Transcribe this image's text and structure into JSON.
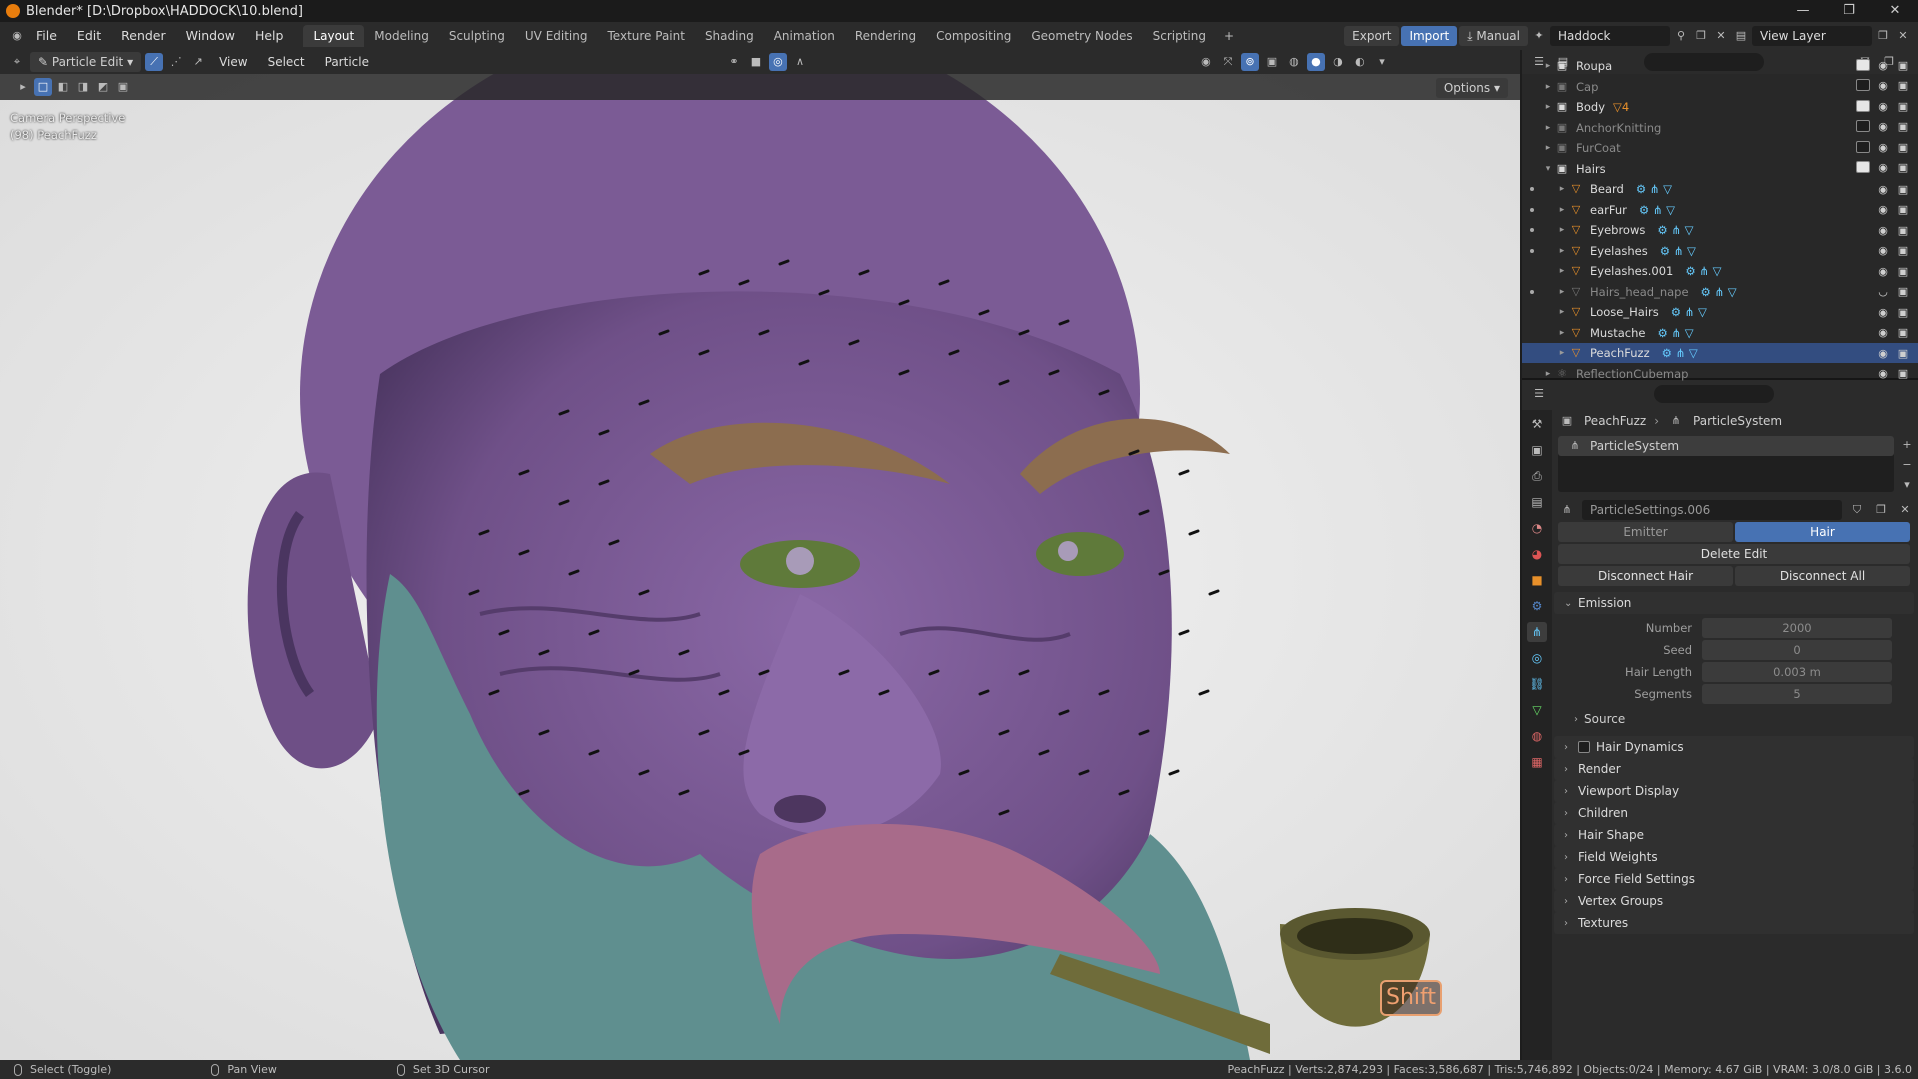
{
  "window": {
    "title": "Blender* [D:\\Dropbox\\HADDOCK\\10.blend]",
    "controls": [
      "—",
      "❐",
      "✕"
    ]
  },
  "menubar": {
    "menus": [
      "File",
      "Edit",
      "Render",
      "Window",
      "Help"
    ],
    "workspaces": [
      "Layout",
      "Modeling",
      "Sculpting",
      "UV Editing",
      "Texture Paint",
      "Shading",
      "Animation",
      "Rendering",
      "Compositing",
      "Geometry Nodes",
      "Scripting"
    ],
    "active_workspace": "Layout",
    "export_label": "Export",
    "import_label": "Import",
    "manual_label": "Manual",
    "scene_name": "Haddock",
    "view_layer": "View Layer"
  },
  "viewport_header": {
    "mode": "Particle Edit",
    "menus": [
      "View",
      "Select",
      "Particle"
    ],
    "options_label": "Options"
  },
  "viewport": {
    "camera_label": "Camera Perspective",
    "object_label": "(98) PeachFuzz",
    "shift_key": "Shift"
  },
  "outliner": {
    "rows": [
      {
        "label": "Roupa",
        "level": 1,
        "type": "collection",
        "visible": true,
        "dim": false
      },
      {
        "label": "Cap",
        "level": 1,
        "type": "collection",
        "dim": true,
        "checked": false
      },
      {
        "label": "Body",
        "level": 1,
        "type": "collection",
        "dim": false,
        "checked": true,
        "badge": "4"
      },
      {
        "label": "AnchorKnitting",
        "level": 1,
        "type": "collection",
        "dim": true,
        "checked": false
      },
      {
        "label": "FurCoat",
        "level": 1,
        "type": "collection",
        "dim": true,
        "checked": false
      },
      {
        "label": "Hairs",
        "level": 1,
        "type": "collection",
        "dim": false,
        "checked": true,
        "expanded": true
      },
      {
        "label": "Beard",
        "level": 2,
        "type": "object",
        "dim": false
      },
      {
        "label": "earFur",
        "level": 2,
        "type": "object",
        "dim": false
      },
      {
        "label": "Eyebrows",
        "level": 2,
        "type": "object",
        "dim": false
      },
      {
        "label": "Eyelashes",
        "level": 2,
        "type": "object",
        "dim": false
      },
      {
        "label": "Eyelashes.001",
        "level": 2,
        "type": "object",
        "dim": false
      },
      {
        "label": "Hairs_head_nape",
        "level": 2,
        "type": "object",
        "dim": true
      },
      {
        "label": "Loose_Hairs",
        "level": 2,
        "type": "object",
        "dim": false
      },
      {
        "label": "Mustache",
        "level": 2,
        "type": "object",
        "dim": false
      },
      {
        "label": "PeachFuzz",
        "level": 2,
        "type": "object",
        "dim": false,
        "selected": true
      },
      {
        "label": "ReflectionCubemap",
        "level": 1,
        "type": "probe",
        "dim": true
      }
    ]
  },
  "properties": {
    "breadcrumb": [
      "PeachFuzz",
      "ParticleSystem"
    ],
    "particle_system": "ParticleSystem",
    "settings_name": "ParticleSettings.006",
    "type_options": [
      "Emitter",
      "Hair"
    ],
    "active_type": "Hair",
    "delete_edit": "Delete Edit",
    "disconnect_hair": "Disconnect Hair",
    "disconnect_all": "Disconnect All",
    "emission": {
      "title": "Emission",
      "fields": [
        {
          "label": "Number",
          "value": "2000"
        },
        {
          "label": "Seed",
          "value": "0"
        },
        {
          "label": "Hair Length",
          "value": "0.003 m"
        },
        {
          "label": "Segments",
          "value": "5"
        }
      ],
      "source": "Source"
    },
    "panels": [
      "Hair Dynamics",
      "Render",
      "Viewport Display",
      "Children",
      "Hair Shape",
      "Field Weights",
      "Force Field Settings",
      "Vertex Groups",
      "Textures"
    ]
  },
  "statusbar": {
    "select": "Select (Toggle)",
    "pan": "Pan View",
    "cursor": "Set 3D Cursor",
    "stats": "PeachFuzz | Verts:2,874,293 | Faces:3,586,687 | Tris:5,746,892 | Objects:0/24 | Memory: 4.67 GiB | VRAM: 3.0/8.0 GiB | 3.6.0"
  },
  "colors": {
    "accent": "#4772b3",
    "skin": "#7d5c96",
    "beard": "#5f8f8f",
    "mustache": "#a86b8a",
    "eyebrow": "#8c6d4f",
    "pipe": "#6f6c3a"
  }
}
